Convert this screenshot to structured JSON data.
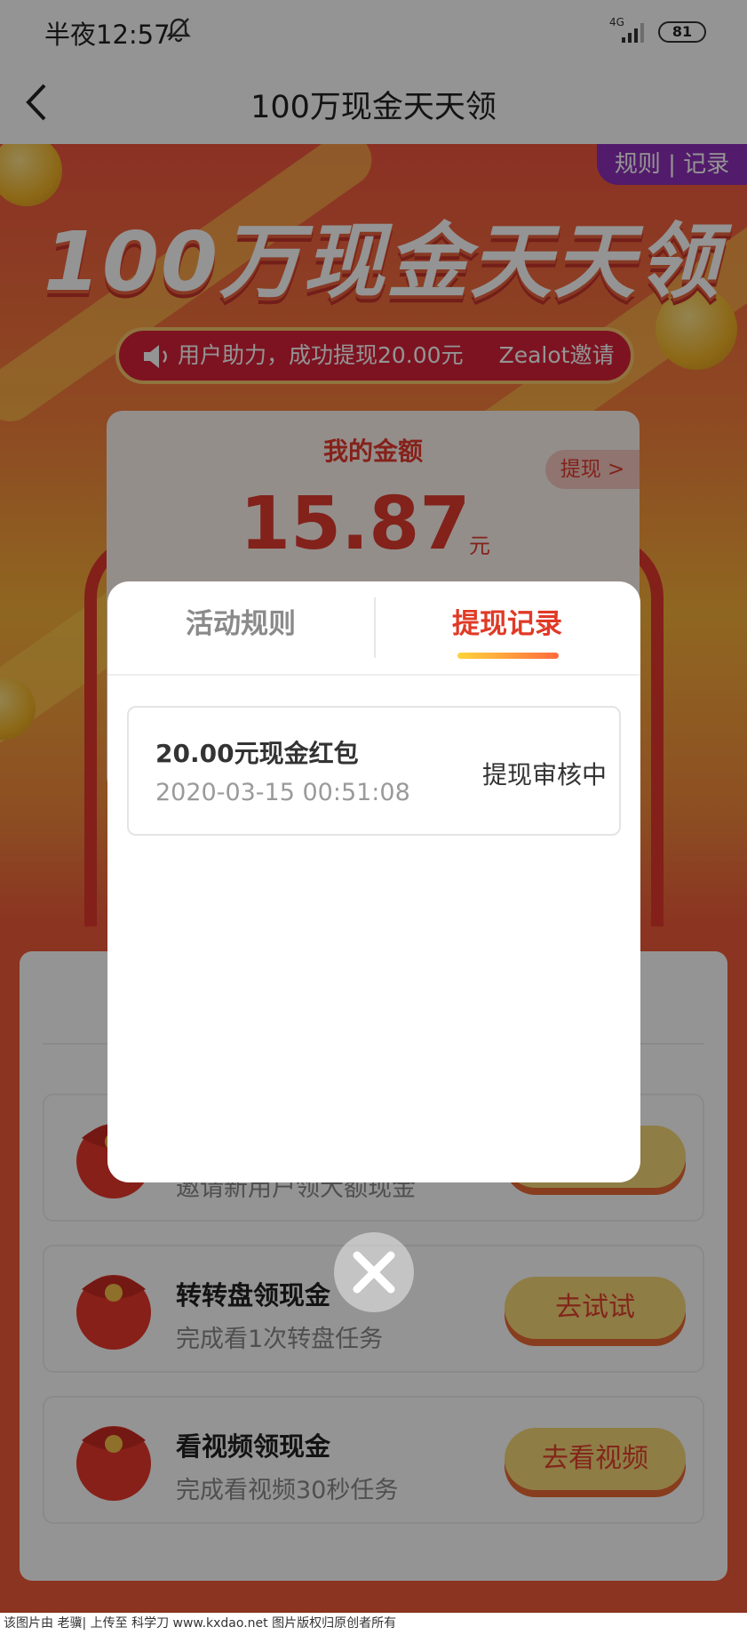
{
  "status_bar": {
    "time": "半夜12:57",
    "network": "4G",
    "battery": "81"
  },
  "nav": {
    "title": "100万现金天天领"
  },
  "hero": {
    "rules_tab": "规则 | 记录",
    "banner_title": "100万现金天天领",
    "ticker": [
      "用户助力，成功提现20.00元",
      "Zealot邀请"
    ],
    "card_label": "我的金额",
    "amount": "15.87",
    "amount_unit": "元",
    "withdraw_label": "提现 >"
  },
  "tasks": [
    {
      "name": "",
      "desc": "邀请新用户领大额现金",
      "button": ""
    },
    {
      "name": "转转盘领现金",
      "desc": "完成看1次转盘任务",
      "button": "去试试"
    },
    {
      "name": "看视频领现金",
      "desc": "完成看视频30秒任务",
      "button": "去看视频"
    }
  ],
  "modal": {
    "tabs": [
      {
        "label": "活动规则",
        "active": false
      },
      {
        "label": "提现记录",
        "active": true
      }
    ],
    "records": [
      {
        "title": "20.00元现金红包",
        "time": "2020-03-15 00:51:08",
        "status": "提现审核中"
      }
    ]
  },
  "footer": {
    "text": "该图片由 老骥| 上传至 科学刀 www.kxdao.net 图片版权归原创者所有"
  },
  "colors": {
    "accent_red": "#e03a26",
    "button_yellow": "#f7d879",
    "purple_tab": "#8e2fb8"
  }
}
